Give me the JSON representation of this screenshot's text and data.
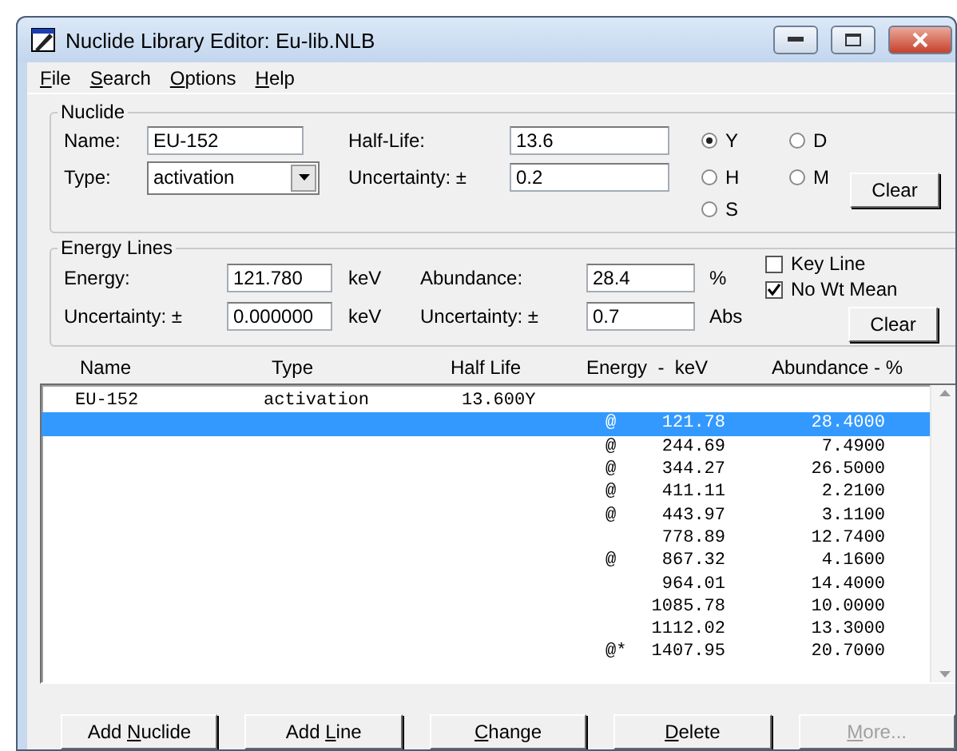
{
  "window": {
    "title": "Nuclide Library Editor: Eu-lib.NLB"
  },
  "menu": [
    {
      "key": "F",
      "rest": "ile"
    },
    {
      "key": "S",
      "rest": "earch"
    },
    {
      "key": "O",
      "rest": "ptions"
    },
    {
      "key": "H",
      "rest": "elp"
    }
  ],
  "nuclide": {
    "legend": "Nuclide",
    "name_label": "Name:",
    "name_value": "EU-152",
    "type_label": "Type:",
    "type_value": "activation",
    "half_life_label": "Half-Life:",
    "half_life_value": "13.6",
    "uncertainty_label": "Uncertainty:  ±",
    "uncertainty_value": "0.2",
    "units": [
      {
        "label": "Y",
        "selected": true
      },
      {
        "label": "D",
        "selected": false
      },
      {
        "label": "H",
        "selected": false
      },
      {
        "label": "M",
        "selected": false
      },
      {
        "label": "S",
        "selected": false
      }
    ],
    "clear": "Clear"
  },
  "energy_lines": {
    "legend": "Energy Lines",
    "energy_label": "Energy:",
    "energy_value": "121.780",
    "energy_unit": "keV",
    "energy_unc_label": "Uncertainty:  ±",
    "energy_unc_value": "0.000000",
    "energy_unc_unit": "keV",
    "abundance_label": "Abundance:",
    "abundance_value": "28.4",
    "abundance_unit": "%",
    "abundance_unc_label": "Uncertainty:  ±",
    "abundance_unc_value": "0.7",
    "abundance_unc_unit": "Abs",
    "options": [
      {
        "label": "Key Line",
        "checked": false
      },
      {
        "label": "No Wt Mean",
        "checked": true
      }
    ],
    "clear": "Clear"
  },
  "list": {
    "columns": [
      "Name",
      "Type",
      "Half Life",
      "Energy  -  keV",
      "Abundance - %"
    ],
    "nuclide": {
      "name": "EU-152",
      "type": "activation",
      "half_life": "13.600Y"
    },
    "rows": [
      {
        "flag": "@",
        "energy": "121.78",
        "abundance": "28.4000",
        "selected": true
      },
      {
        "flag": "@",
        "energy": "244.69",
        "abundance": "7.4900",
        "selected": false
      },
      {
        "flag": "@",
        "energy": "344.27",
        "abundance": "26.5000",
        "selected": false
      },
      {
        "flag": "@",
        "energy": "411.11",
        "abundance": "2.2100",
        "selected": false
      },
      {
        "flag": "@",
        "energy": "443.97",
        "abundance": "3.1100",
        "selected": false
      },
      {
        "energy": "778.89",
        "abundance": "12.7400",
        "selected": false
      },
      {
        "flag": "@",
        "energy": "867.32",
        "abundance": "4.1600",
        "selected": false
      },
      {
        "energy": "964.01",
        "abundance": "14.4000",
        "selected": false
      },
      {
        "energy": "1085.78",
        "abundance": "10.0000",
        "selected": false
      },
      {
        "energy": "1112.02",
        "abundance": "13.3000",
        "selected": false
      },
      {
        "flag": "@*",
        "energy": "1407.95",
        "abundance": "20.7000",
        "selected": false
      }
    ]
  },
  "buttons": [
    {
      "before": "Add ",
      "key": "N",
      "rest": "uclide",
      "disabled": false
    },
    {
      "before": "Add ",
      "key": "L",
      "rest": "ine",
      "disabled": false
    },
    {
      "key": "C",
      "rest": "hange",
      "disabled": false
    },
    {
      "key": "D",
      "rest": "elete",
      "disabled": false
    },
    {
      "key": "M",
      "rest": "ore...",
      "disabled": true
    }
  ]
}
